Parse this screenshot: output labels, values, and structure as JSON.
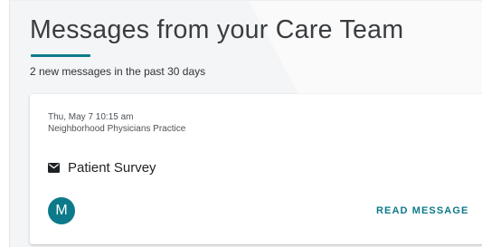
{
  "header": {
    "title": "Messages from your Care Team",
    "subtitle": "2 new messages in the past 30 days"
  },
  "message": {
    "date": "Thu, May 7 10:15 am",
    "practice": "Neighborhood Physicians Practice",
    "subject_icon": "envelope-icon",
    "subject": "Patient Survey",
    "avatar_initial": "M",
    "read_label": "READ MESSAGE"
  },
  "colors": {
    "accent": "#0c7a8a",
    "background": "#f4f5f6",
    "card": "#ffffff",
    "title_text": "#3a3d40"
  }
}
